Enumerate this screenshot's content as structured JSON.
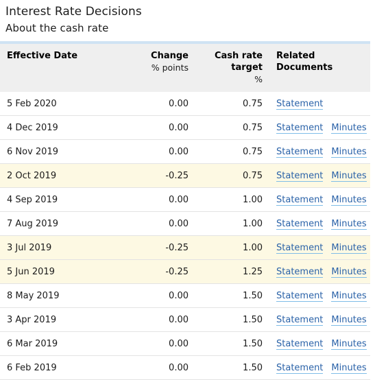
{
  "header": {
    "title": "Interest Rate Decisions",
    "subtitle": "About the cash rate"
  },
  "table": {
    "columns": [
      {
        "label": "Effective Date",
        "sub": ""
      },
      {
        "label": "Change",
        "sub": "% points"
      },
      {
        "label": "Cash rate target",
        "sub": "%"
      },
      {
        "label": "Related Documents",
        "sub": ""
      }
    ],
    "accent_color": "#cfe3f3",
    "header_bg": "#efefef",
    "highlight_bg": "#fdf9e3",
    "link_color": "#2a62a8",
    "rows": [
      {
        "date": "5 Feb 2020",
        "change": "0.00",
        "rate": "0.75",
        "statement": "Statement",
        "minutes": "",
        "highlight": false
      },
      {
        "date": "4 Dec 2019",
        "change": "0.00",
        "rate": "0.75",
        "statement": "Statement",
        "minutes": "Minutes",
        "highlight": false
      },
      {
        "date": "6 Nov 2019",
        "change": "0.00",
        "rate": "0.75",
        "statement": "Statement",
        "minutes": "Minutes",
        "highlight": false
      },
      {
        "date": "2 Oct 2019",
        "change": "-0.25",
        "rate": "0.75",
        "statement": "Statement",
        "minutes": "Minutes",
        "highlight": true
      },
      {
        "date": "4 Sep 2019",
        "change": "0.00",
        "rate": "1.00",
        "statement": "Statement",
        "minutes": "Minutes",
        "highlight": false
      },
      {
        "date": "7 Aug 2019",
        "change": "0.00",
        "rate": "1.00",
        "statement": "Statement",
        "minutes": "Minutes",
        "highlight": false
      },
      {
        "date": "3 Jul 2019",
        "change": "-0.25",
        "rate": "1.00",
        "statement": "Statement",
        "minutes": "Minutes",
        "highlight": true
      },
      {
        "date": "5 Jun 2019",
        "change": "-0.25",
        "rate": "1.25",
        "statement": "Statement",
        "minutes": "Minutes",
        "highlight": true
      },
      {
        "date": "8 May 2019",
        "change": "0.00",
        "rate": "1.50",
        "statement": "Statement",
        "minutes": "Minutes",
        "highlight": false
      },
      {
        "date": "3 Apr 2019",
        "change": "0.00",
        "rate": "1.50",
        "statement": "Statement",
        "minutes": "Minutes",
        "highlight": false
      },
      {
        "date": "6 Mar 2019",
        "change": "0.00",
        "rate": "1.50",
        "statement": "Statement",
        "minutes": "Minutes",
        "highlight": false
      },
      {
        "date": "6 Feb 2019",
        "change": "0.00",
        "rate": "1.50",
        "statement": "Statement",
        "minutes": "Minutes",
        "highlight": false
      }
    ]
  }
}
